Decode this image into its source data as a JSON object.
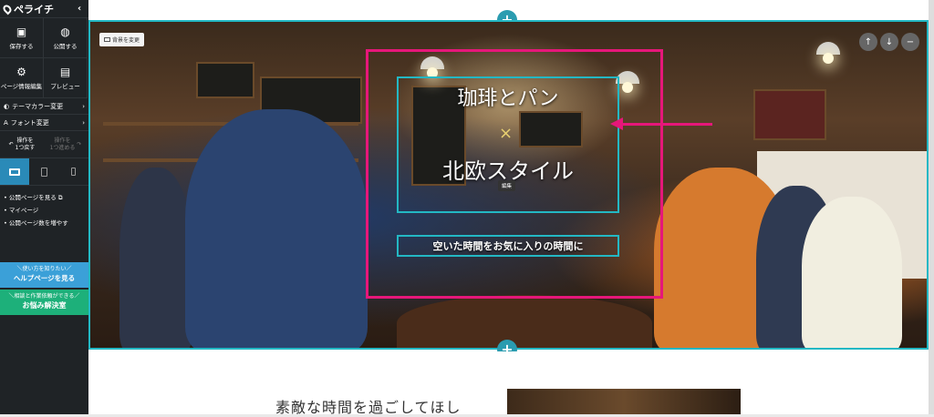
{
  "app": {
    "logo": "ペライチ"
  },
  "sidebar": {
    "save": "保存する",
    "publish": "公開する",
    "page_info": "ページ情報編集",
    "preview": "プレビュー",
    "theme_color": "テーマカラー変更",
    "font_change": "フォント変更",
    "undo": "操作を\n1つ戻す",
    "redo": "操作を\n1つ進める",
    "links": [
      "公開ページを見る",
      "マイページ",
      "公開ページ数を増やす"
    ],
    "help_top": "＼使い方を知りたい／",
    "help_main": "ヘルプページを見る",
    "consult_top": "＼相談と作業依頼ができる／",
    "consult_main": "お悩み解決室"
  },
  "hero": {
    "bg_change": "背景を変更",
    "title": "珈琲とパン",
    "cross": "×",
    "subtitle": "北欧スタイル",
    "edit": "編集",
    "tagline": "空いた時間をお気に入りの時間に"
  },
  "below": {
    "text": "素敵な時間を過ごしてほし"
  },
  "colors": {
    "accent_pink": "#e6177a",
    "accent_teal": "#23b8c4",
    "sidebar_bg": "#1f2326",
    "help": "#3ba0d8",
    "consult": "#1db07a"
  }
}
